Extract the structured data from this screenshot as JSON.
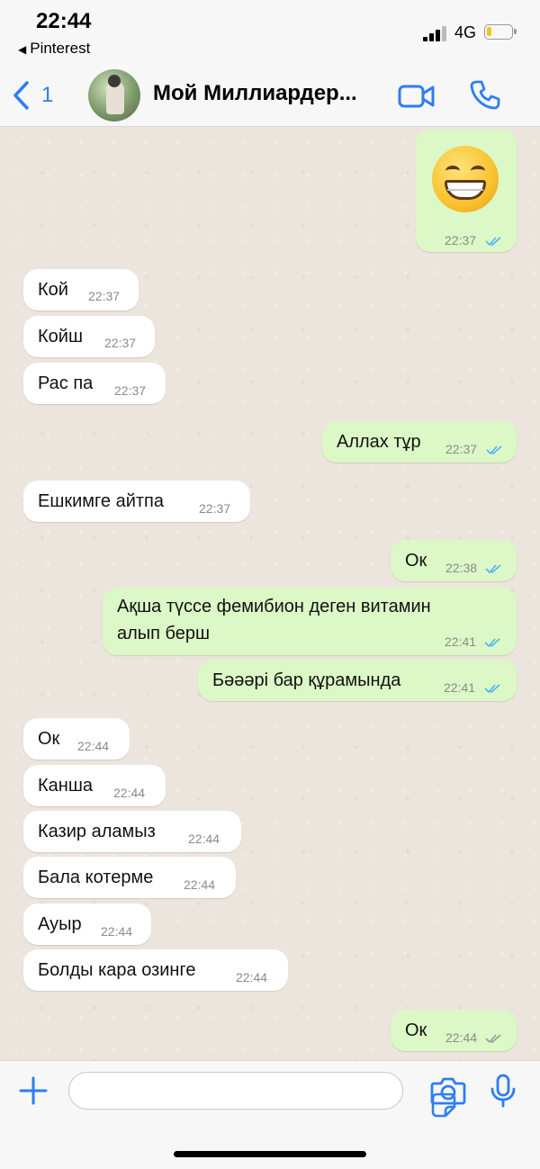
{
  "status": {
    "time": "22:44",
    "back_app": "Pinterest",
    "network": "4G"
  },
  "header": {
    "back_count": "1",
    "contact_name": "Мой Миллиардер..."
  },
  "messages": [
    {
      "dir": "out",
      "emoji": "grinning-face",
      "time": "22:37",
      "status": "read"
    },
    {
      "dir": "in",
      "text": "Кой",
      "time": "22:37"
    },
    {
      "dir": "in",
      "text": "Койш",
      "time": "22:37"
    },
    {
      "dir": "in",
      "text": "Рас па",
      "time": "22:37"
    },
    {
      "dir": "out",
      "text": "Аллах тұр",
      "time": "22:37",
      "status": "read"
    },
    {
      "dir": "in",
      "text": "Ешкимге айтпа",
      "time": "22:37"
    },
    {
      "dir": "out",
      "text": "Ок",
      "time": "22:38",
      "status": "read"
    },
    {
      "dir": "out",
      "text": "Ақша түссе фемибион деген витамин",
      "text2": "алып берш",
      "time": "22:41",
      "status": "read"
    },
    {
      "dir": "out",
      "text": "Бәәәрі бар құрамында",
      "time": "22:41",
      "status": "read"
    },
    {
      "dir": "in",
      "text": "Ок",
      "time": "22:44"
    },
    {
      "dir": "in",
      "text": "Канша",
      "time": "22:44"
    },
    {
      "dir": "in",
      "text": "Казир аламыз",
      "time": "22:44"
    },
    {
      "dir": "in",
      "text": "Бала котерме",
      "time": "22:44"
    },
    {
      "dir": "in",
      "text": "Ауыр",
      "time": "22:44"
    },
    {
      "dir": "in",
      "text": "Болды кара озинге",
      "time": "22:44"
    },
    {
      "dir": "out",
      "text": "Ок",
      "time": "22:44",
      "status": "delivered"
    }
  ],
  "colors": {
    "accent": "#2e7df6",
    "outgoing_bubble": "#dcf8c6",
    "incoming_bubble": "#ffffff",
    "chat_bg": "#ece5dd",
    "read_ticks": "#4fb4f5",
    "delivered_ticks": "#9a9a9a"
  }
}
